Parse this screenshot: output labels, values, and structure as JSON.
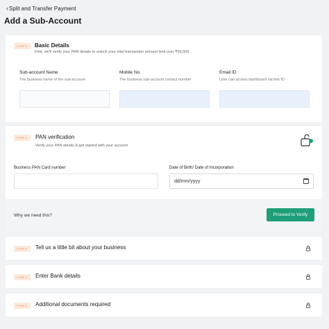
{
  "header": {
    "back_label": "Split and Transfer Payment",
    "title": "Add a Sub-Account"
  },
  "step1": {
    "badge": "STEP 1",
    "title": "Basic Details",
    "subtitle": "First, we'll verify your PAN details to unlock your total transaction amount limit over ₹50,000",
    "fields": [
      {
        "label": "Sub-account Name",
        "hint": "The business name of the sub-account"
      },
      {
        "label": "Mobile No.",
        "hint": "The business sub-account contact number"
      },
      {
        "label": "Email ID",
        "hint": "User can access dashboard via this ID"
      }
    ]
  },
  "step2": {
    "badge": "STEP 2",
    "title": "PAN verification",
    "subtitle": "Verify your PAN details & get started with your account.",
    "pan_label": "Business PAN Card number",
    "dob_label": "Date of Birth/ Date of Incorporation",
    "dob_placeholder": "dd/mm/yyyy",
    "why_label": "Why we need this?",
    "verify_button": "Proceed to Verify"
  },
  "step3": {
    "badge": "STEP 3",
    "title": "Tell us a little bit about your business"
  },
  "step4": {
    "badge": "STEP 4",
    "title": "Enter Bank details"
  },
  "step5": {
    "badge": "STEP 5",
    "title": "Additional documents required"
  },
  "colors": {
    "accent": "#1e9f7a",
    "badge_bg": "#fde9dc",
    "badge_text": "#e58a5a"
  },
  "icons": {
    "back": "chevron-left-icon",
    "unlock": "unlock-icon",
    "lock": "lock-icon",
    "calendar": "calendar-icon"
  }
}
